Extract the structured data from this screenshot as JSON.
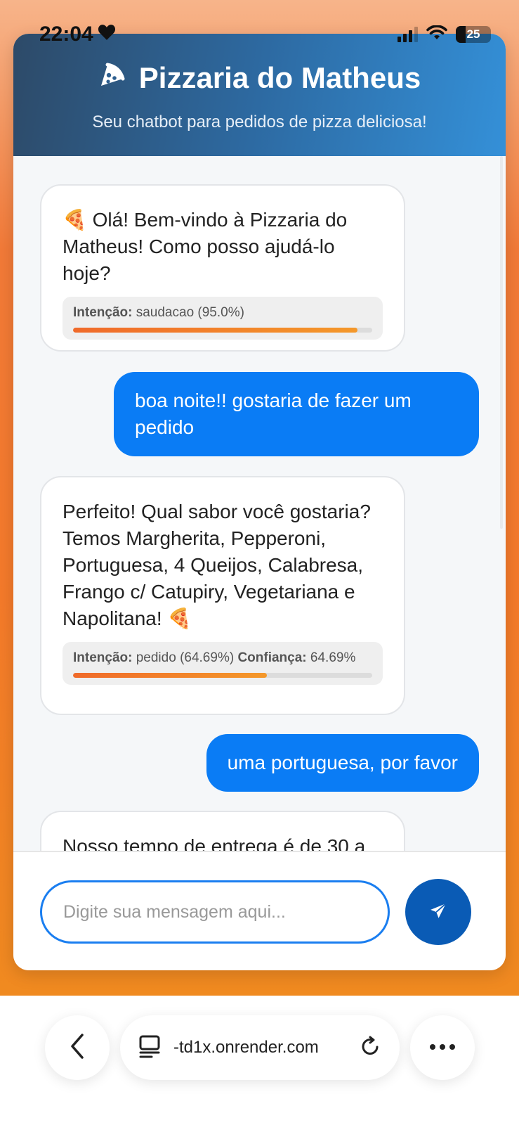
{
  "status_bar": {
    "time": "22:04",
    "battery": "25"
  },
  "header": {
    "title": "Pizzaria do Matheus",
    "subtitle": "Seu chatbot para pedidos de pizza deliciosa!"
  },
  "messages": [
    {
      "from": "bot",
      "text": "🍕 Olá! Bem-vindo à Pizzaria do Matheus! Como posso ajudá-lo hoje?",
      "intent_label": "Intenção:",
      "intent_value": "saudacao (95.0%)",
      "confidence": 0.95
    },
    {
      "from": "user",
      "text": "boa noite!! gostaria de fazer um pedido"
    },
    {
      "from": "bot",
      "text": "Perfeito! Qual sabor você gostaria? Temos Margherita, Pepperoni, Portuguesa, 4 Queijos, Calabresa, Frango c/ Catupiry, Vegetariana e Napolitana! 🍕",
      "intent_label": "Intenção:",
      "intent_value": "pedido (64.69%)",
      "confidence_label": "Confiança:",
      "confidence_value": "64.69%",
      "confidence": 0.6469
    },
    {
      "from": "user",
      "text": "uma portuguesa, por favor"
    },
    {
      "from": "bot",
      "text": "Nosso tempo de entrega é de 30 a"
    }
  ],
  "input": {
    "placeholder": "Digite sua mensagem aqui...",
    "value": ""
  },
  "browser": {
    "url": "-td1x.onrender.com"
  },
  "colors": {
    "accent": "#0a7cf5",
    "header_start": "#2d4a68",
    "header_end": "#3490d8",
    "bar_fill": "#f06a2a",
    "send_button": "#0a5bb5"
  },
  "icons": {
    "brand": "pizza-slice-icon",
    "send": "paper-plane-icon",
    "back": "chevron-left-icon",
    "tabs": "tab-overview-icon",
    "reload": "reload-icon",
    "more": "more-dots-icon"
  }
}
